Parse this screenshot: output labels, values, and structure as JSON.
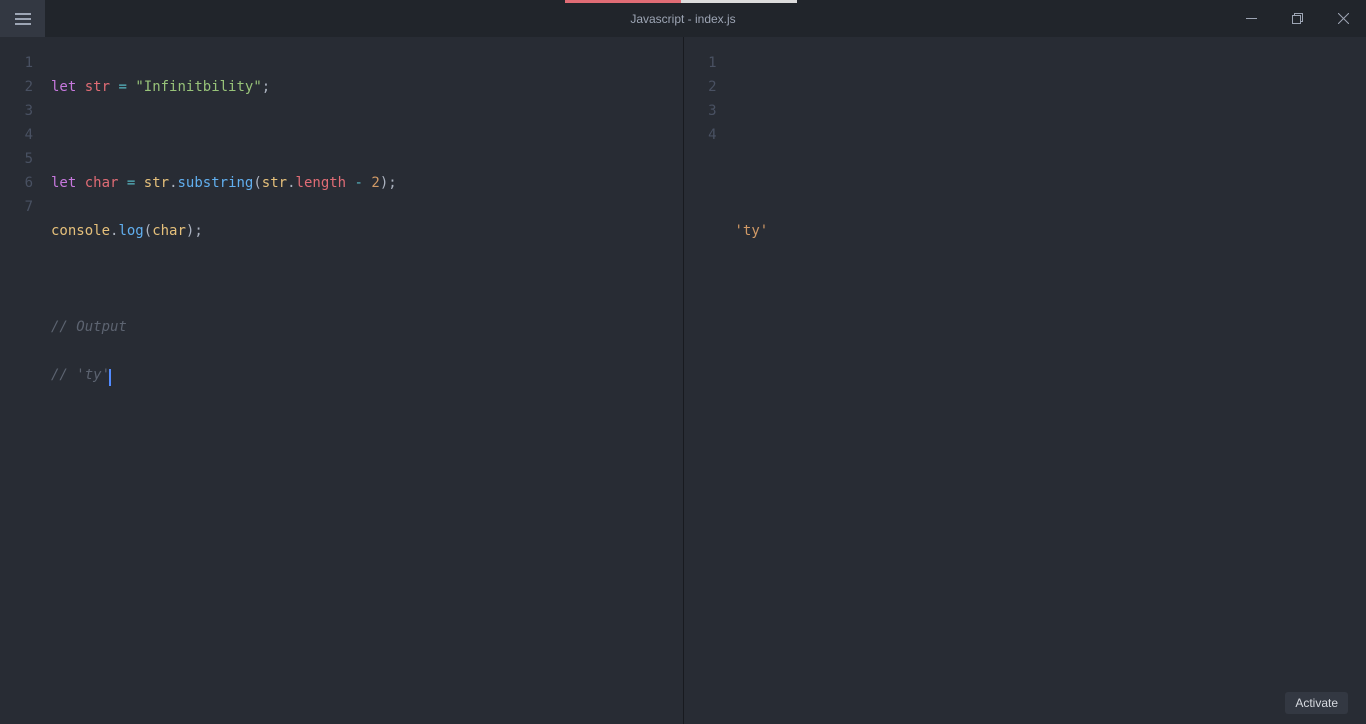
{
  "titlebar": {
    "title": "Javascript - index.js"
  },
  "leftEditor": {
    "lineNumbers": [
      "1",
      "2",
      "3",
      "4",
      "5",
      "6",
      "7"
    ],
    "tokens": {
      "let": "let",
      "str": "str",
      "eq": "=",
      "strLiteral": "\"Infinitbility\"",
      "semi": ";",
      "char": "char",
      "dot": ".",
      "substring": "substring",
      "lp": "(",
      "rp": ")",
      "length": "length",
      "minus": "-",
      "two": "2",
      "console": "console",
      "log": "log",
      "commentOutput": "// Output",
      "commentTy": "// 'ty'"
    }
  },
  "rightEditor": {
    "lineNumbers": [
      "1",
      "2",
      "3",
      "4"
    ],
    "outputLine": "'ty'"
  },
  "activateLabel": "Activate"
}
